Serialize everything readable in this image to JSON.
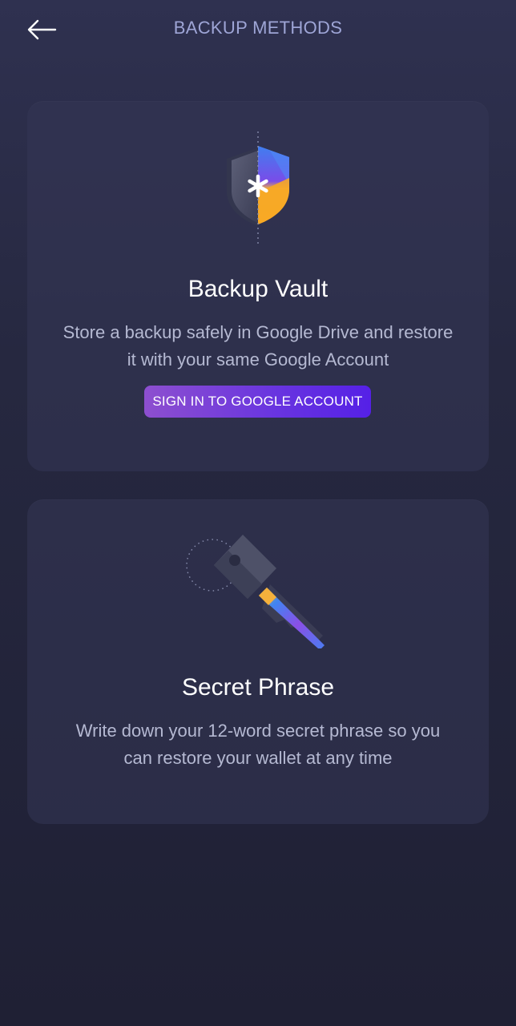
{
  "header": {
    "title": "BACKUP METHODS",
    "back_icon": "arrow-left-icon"
  },
  "cards": {
    "vault": {
      "icon": "shield-icon",
      "title": "Backup Vault",
      "description": "Store a backup safely in Google Drive and restore it with your same Google Account",
      "button_label": "SIGN IN TO GOOGLE ACCOUNT"
    },
    "phrase": {
      "icon": "key-icon",
      "title": "Secret Phrase",
      "description": "Write down your 12-word secret phrase so you can restore your wallet at any time"
    }
  },
  "colors": {
    "accent_start": "#8d4fcf",
    "accent_end": "#5520e6",
    "title_text": "#9ea5d6",
    "body_text": "#b5b9d2"
  }
}
